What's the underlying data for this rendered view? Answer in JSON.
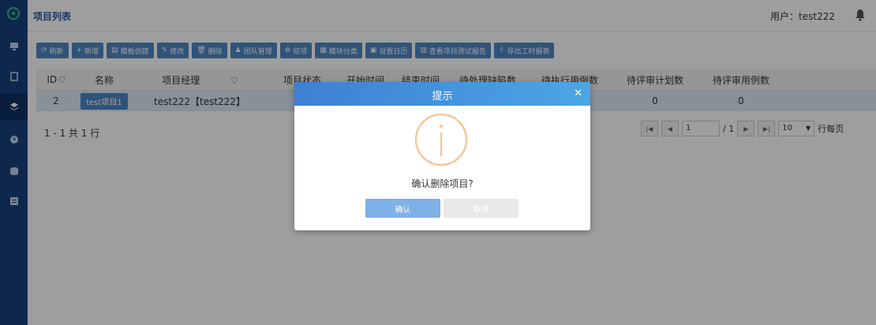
{
  "header": {
    "page_title": "项目列表",
    "user_label": "用户：test222"
  },
  "toolbar": [
    {
      "icon": "refresh-icon",
      "glyph": "⟳",
      "label": "刷新"
    },
    {
      "icon": "plus-icon",
      "glyph": "+",
      "label": "新增"
    },
    {
      "icon": "template-icon",
      "glyph": "▤",
      "label": "模板创建"
    },
    {
      "icon": "edit-icon",
      "glyph": "✎",
      "label": "修改"
    },
    {
      "icon": "trash-icon",
      "glyph": "🗑",
      "label": "删除"
    },
    {
      "icon": "team-icon",
      "glyph": "♟",
      "label": "团队管理"
    },
    {
      "icon": "close-circle-icon",
      "glyph": "⊗",
      "label": "结项"
    },
    {
      "icon": "module-icon",
      "glyph": "▦",
      "label": "模块分类"
    },
    {
      "icon": "calendar-icon",
      "glyph": "▣",
      "label": "设置日历"
    },
    {
      "icon": "bar-chart-icon",
      "glyph": "▥",
      "label": "查看项目测试报告"
    },
    {
      "icon": "export-icon",
      "glyph": "⇪",
      "label": "导出工时报表"
    }
  ],
  "table": {
    "headers": {
      "id": "ID",
      "name": "名称",
      "manager": "项目经理",
      "status": "项目状态",
      "start": "开始时间",
      "end": "结束时间",
      "pending": "待处理缺陷数",
      "exec": "待执行用例数",
      "plan": "待评审计划数",
      "review": "待评审用例数"
    },
    "rows": [
      {
        "id": "2",
        "name": "test项目1",
        "manager": "test222【test222】",
        "exec": "0",
        "plan": "0",
        "review": "0"
      }
    ]
  },
  "footer": {
    "summary": "1 - 1 共 1 行"
  },
  "pager": {
    "current_page": "1",
    "total_pages": "/ 1",
    "page_size": "10",
    "per_page_label": "行每页"
  },
  "dialog": {
    "title": "提示",
    "message": "确认删除项目?",
    "ok_label": "确认",
    "cancel_label": "取消"
  },
  "colors": {
    "sidebar": "#18427c",
    "accent": "#4d87c7",
    "warning_icon": "#f5c79a"
  }
}
